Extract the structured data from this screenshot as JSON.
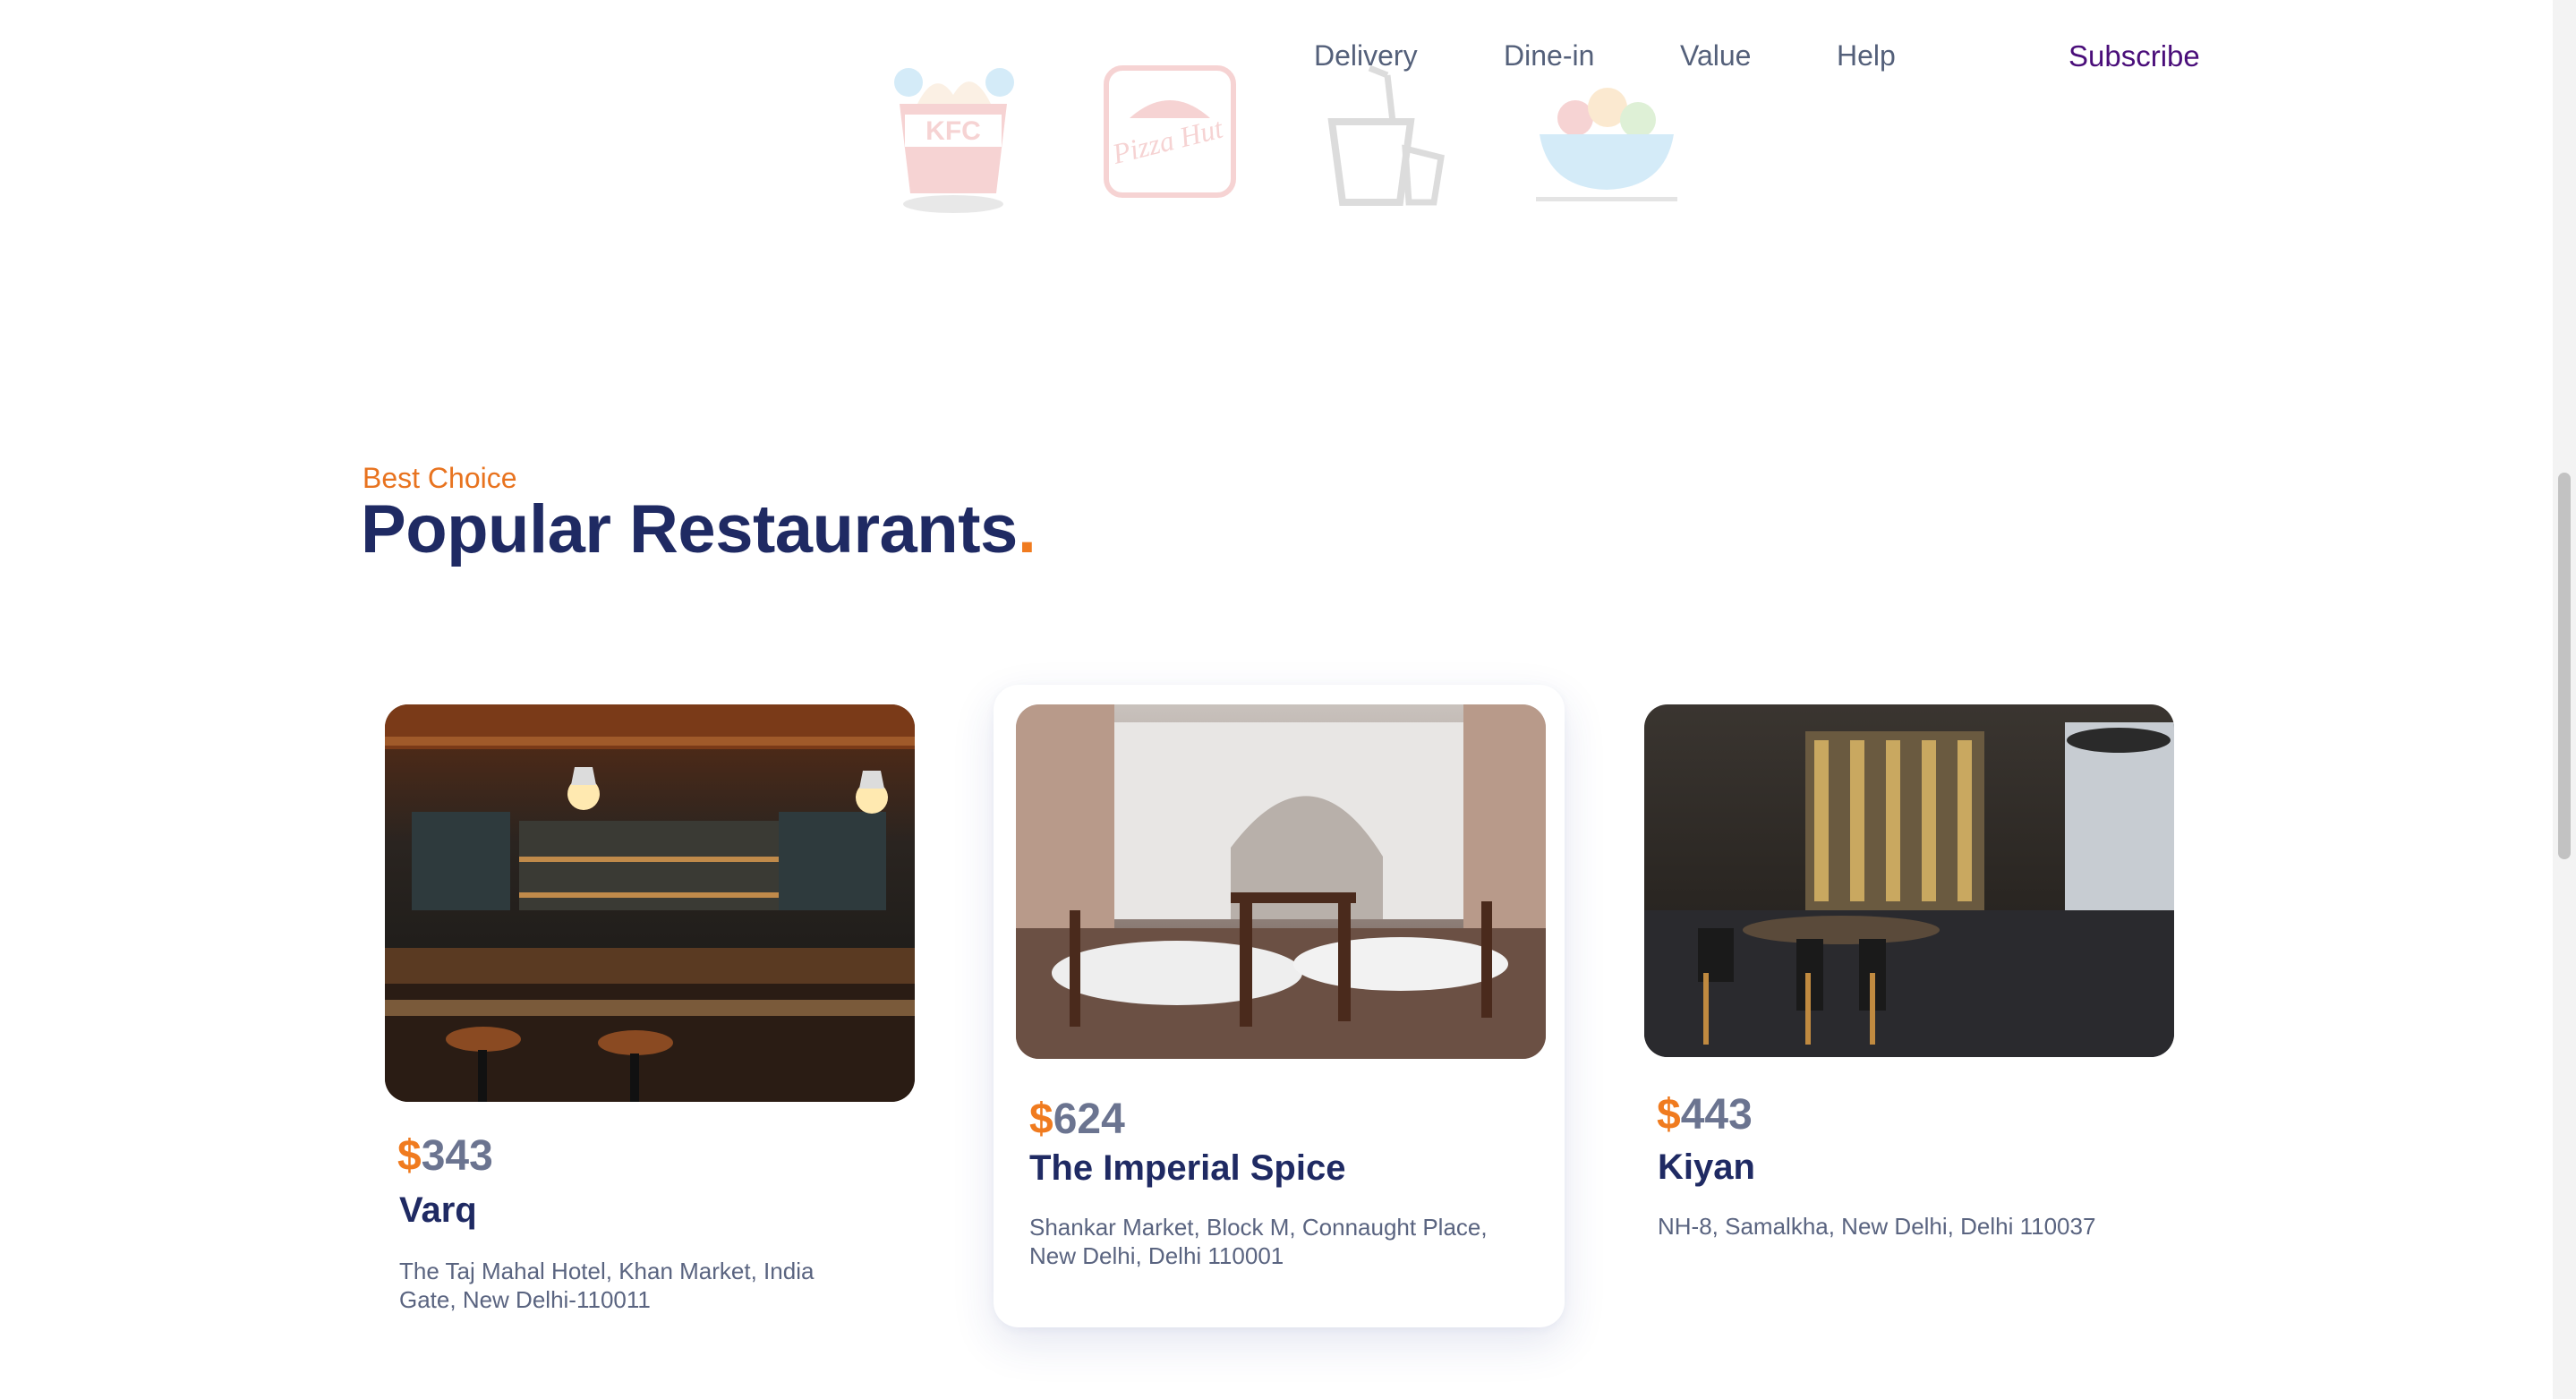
{
  "nav": {
    "links": [
      "Delivery",
      "Dine-in",
      "Value",
      "Help"
    ],
    "subscribe": "Subscribe"
  },
  "brand_logos": [
    {
      "icon": "kfc-bucket-icon",
      "text": "KFC"
    },
    {
      "icon": "pizza-hut-icon",
      "text": "Pizza Hut"
    },
    {
      "icon": "takeout-box-icon"
    },
    {
      "icon": "food-bowl-icon"
    }
  ],
  "section": {
    "eyebrow": "Best Choice",
    "title": "Popular Restaurants",
    "title_dot": "."
  },
  "restaurants": [
    {
      "currency": "$",
      "price": "343",
      "name": "Varq",
      "address": "The Taj Mahal Hotel, Khan Market, India Gate, New Delhi-110011",
      "image": "restaurant-bar-photo"
    },
    {
      "currency": "$",
      "price": "624",
      "name": "The Imperial Spice",
      "address": "Shankar Market, Block M, Connaught Place, New Delhi, Delhi 110001",
      "image": "restaurant-dining-room-photo"
    },
    {
      "currency": "$",
      "price": "443",
      "name": "Kiyan",
      "address": "NH-8, Samalkha, New Delhi, Delhi 110037",
      "image": "restaurant-modern-interior-photo"
    }
  ],
  "colors": {
    "accent": "#f07b1f",
    "heading": "#1f2a63",
    "subscribe": "#4a0e7a"
  }
}
